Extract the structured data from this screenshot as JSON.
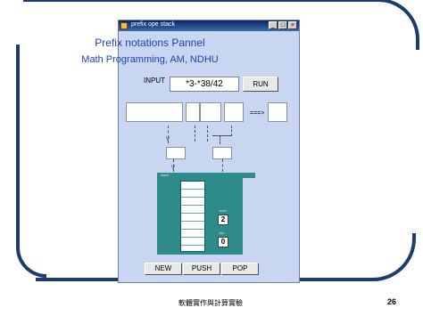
{
  "window": {
    "title": "prefix ope stack"
  },
  "heading": {
    "line1": "Prefix notations Pannel",
    "line2": "Math Programming, AM, NDHU"
  },
  "input": {
    "label": "INPUT",
    "value": "*3-*38/42"
  },
  "buttons": {
    "run": "RUN",
    "new": "NEW",
    "push": "PUSH",
    "pop": "POP"
  },
  "arrow_label": "===>",
  "wire_marks": {
    "left": "V",
    "mid": "V"
  },
  "stack": {
    "slot_count": 8,
    "labels": {
      "header": "stack",
      "top": "num",
      "bottom": "top"
    },
    "count_value": "2",
    "top_value": "0"
  },
  "footer": {
    "text": "軟體實作與計算實驗",
    "page": "26"
  }
}
